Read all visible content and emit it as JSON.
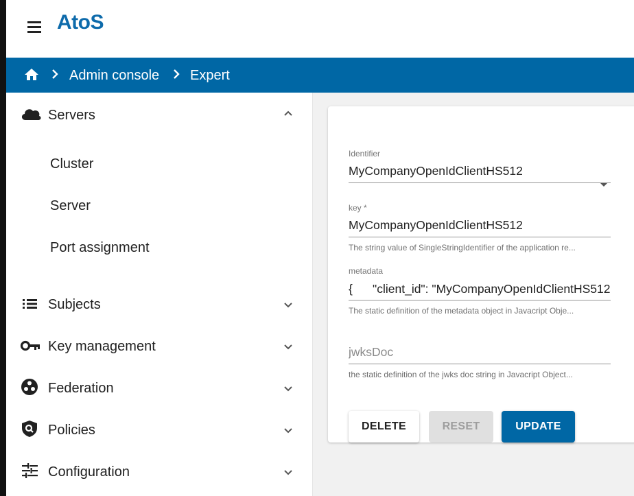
{
  "header": {
    "logo_text": "AtoS",
    "menu_icon": "hamburger-icon"
  },
  "breadcrumb": {
    "home_icon": "home-icon",
    "items": [
      "Admin console",
      "Expert"
    ]
  },
  "sidebar": {
    "sections": [
      {
        "label": "Servers",
        "icon": "cloud-icon",
        "expanded": true,
        "children": [
          "Cluster",
          "Server",
          "Port assignment"
        ]
      },
      {
        "label": "Subjects",
        "icon": "list-icon",
        "expanded": false
      },
      {
        "label": "Key management",
        "icon": "key-icon",
        "expanded": false
      },
      {
        "label": "Federation",
        "icon": "federation-icon",
        "expanded": false
      },
      {
        "label": "Policies",
        "icon": "shield-icon",
        "expanded": false
      },
      {
        "label": "Configuration",
        "icon": "sliders-icon",
        "expanded": false
      }
    ]
  },
  "form": {
    "identifier": {
      "label": "Identifier",
      "value": "MyCompanyOpenIdClientHS512"
    },
    "key": {
      "label": "key *",
      "value": "MyCompanyOpenIdClientHS512",
      "help": "The string value of SingleStringIdentifier of the application re..."
    },
    "metadata": {
      "label": "metadata",
      "value": "{      \"client_id\": \"MyCompanyOpenIdClientHS512",
      "help": "The static definition of the metadata object in Javacript Obje..."
    },
    "jwksDoc": {
      "placeholder": "jwksDoc",
      "help": "the static definition of the jwks doc string in Javacript Object..."
    },
    "buttons": {
      "delete": "DELETE",
      "reset": "RESET",
      "update": "UPDATE"
    }
  },
  "colors": {
    "brand_blue": "#0067a5",
    "logo_blue": "#0e6bab"
  }
}
